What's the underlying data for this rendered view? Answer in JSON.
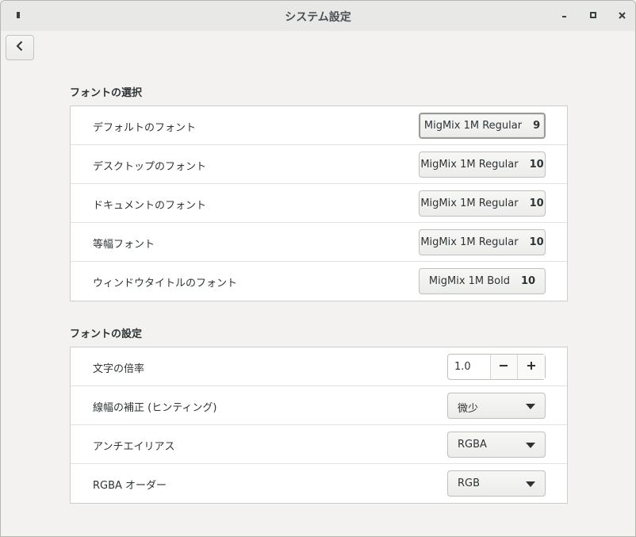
{
  "window": {
    "title": "システム設定"
  },
  "font_selection": {
    "heading": "フォントの選択",
    "rows": [
      {
        "label": "デフォルトのフォント",
        "font": "MigMix 1M Regular",
        "size": "9"
      },
      {
        "label": "デスクトップのフォント",
        "font": "MigMix 1M Regular",
        "size": "10"
      },
      {
        "label": "ドキュメントのフォント",
        "font": "MigMix 1M Regular",
        "size": "10"
      },
      {
        "label": "等幅フォント",
        "font": "MigMix 1M Regular",
        "size": "10"
      },
      {
        "label": "ウィンドウタイトルのフォント",
        "font": "MigMix 1M Bold",
        "size": "10"
      }
    ]
  },
  "font_settings": {
    "heading": "フォントの設定",
    "scale": {
      "label": "文字の倍率",
      "value": "1.0"
    },
    "hinting": {
      "label": "線幅の補正 (ヒンティング)",
      "value": "微少"
    },
    "antialias": {
      "label": "アンチエイリアス",
      "value": "RGBA"
    },
    "rgba_order": {
      "label": "RGBA オーダー",
      "value": "RGB"
    }
  }
}
